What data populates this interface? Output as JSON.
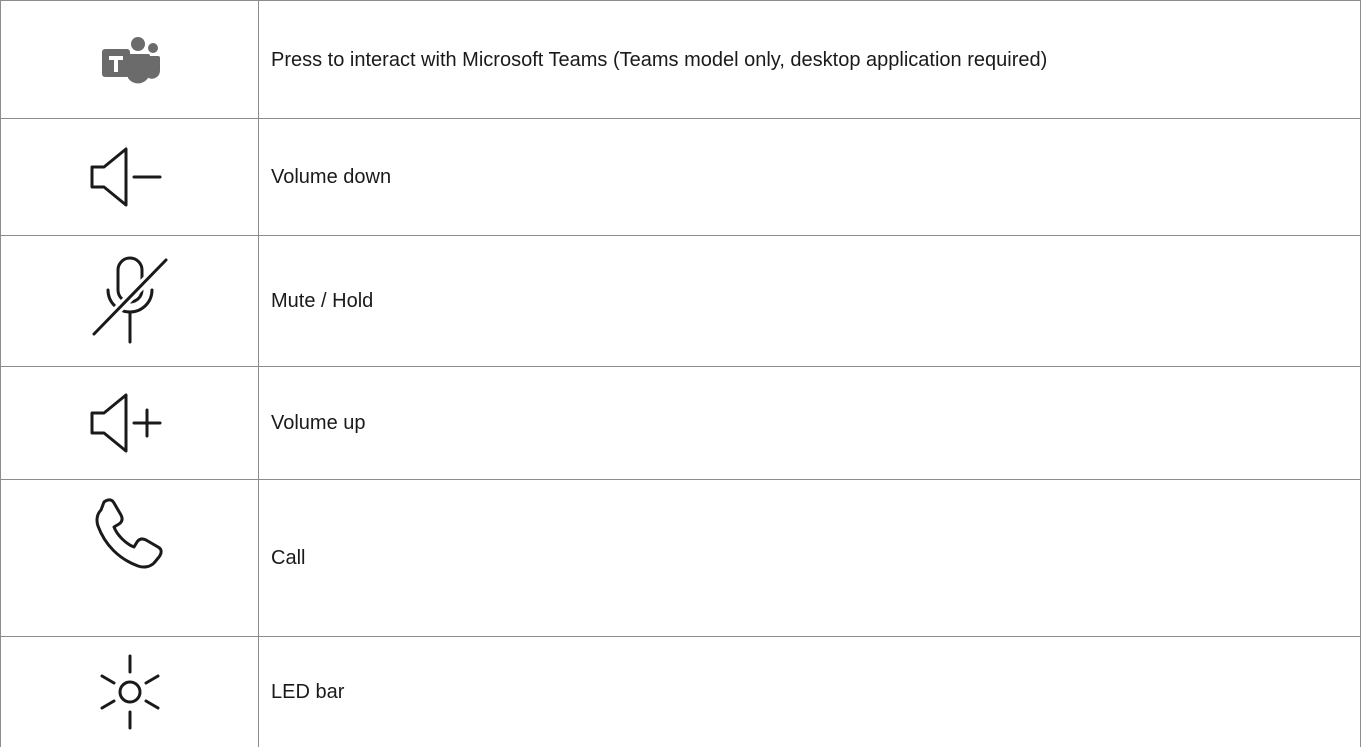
{
  "rows": [
    {
      "icon": "microsoft-teams-icon",
      "description": "Press to interact with Microsoft Teams (Teams model only, desktop application required)"
    },
    {
      "icon": "volume-down-icon",
      "description": "Volume down"
    },
    {
      "icon": "mute-hold-icon",
      "description": "Mute / Hold"
    },
    {
      "icon": "volume-up-icon",
      "description": "Volume up"
    },
    {
      "icon": "call-icon",
      "description": "Call"
    },
    {
      "icon": "led-bar-icon",
      "description": "LED bar"
    }
  ],
  "colors": {
    "icon_stroke": "#1a1a1a",
    "teams_icon_fill": "#6b6b6b",
    "border": "#8c8c8c"
  }
}
